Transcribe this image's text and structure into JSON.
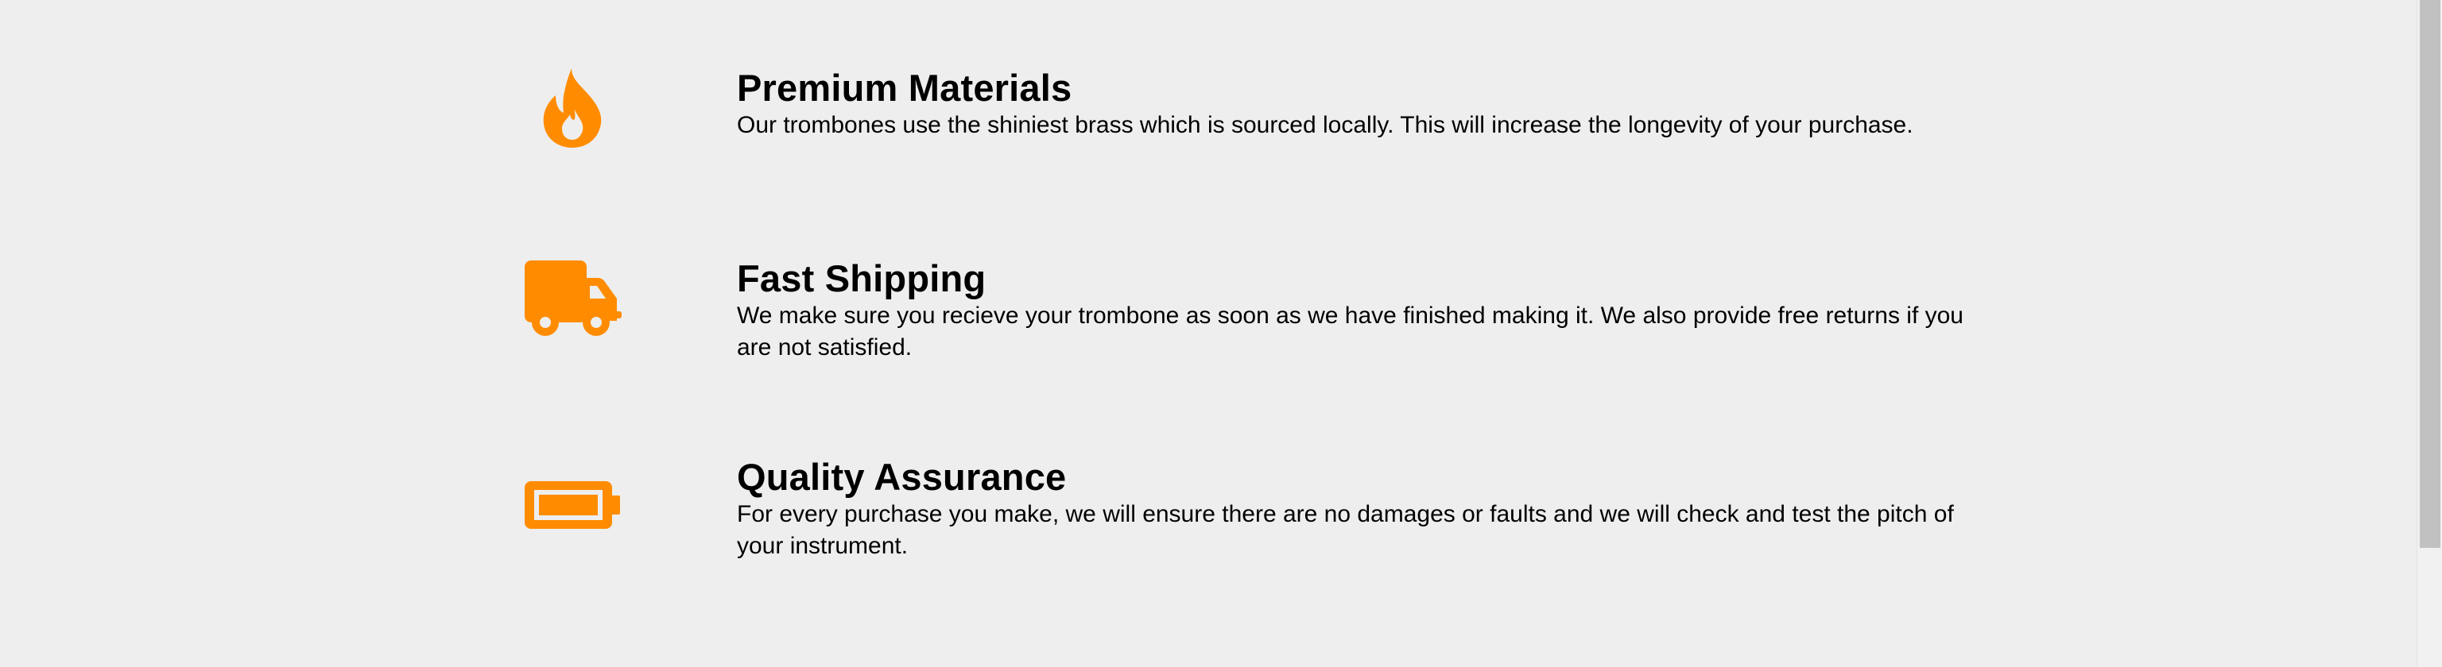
{
  "colors": {
    "accent": "#ff8c00",
    "background": "#eeeeee",
    "text": "#000000"
  },
  "features": [
    {
      "icon": "fire-icon",
      "title": "Premium Materials",
      "description": "Our trombones use the shiniest brass which is sourced locally. This will increase the longevity of your purchase."
    },
    {
      "icon": "truck-icon",
      "title": "Fast Shipping",
      "description": "We make sure you recieve your trombone as soon as we have finished making it. We also provide free returns if you are not satisfied."
    },
    {
      "icon": "battery-icon",
      "title": "Quality Assurance",
      "description": "For every purchase you make, we will ensure there are no damages or faults and we will check and test the pitch of your instrument."
    }
  ]
}
